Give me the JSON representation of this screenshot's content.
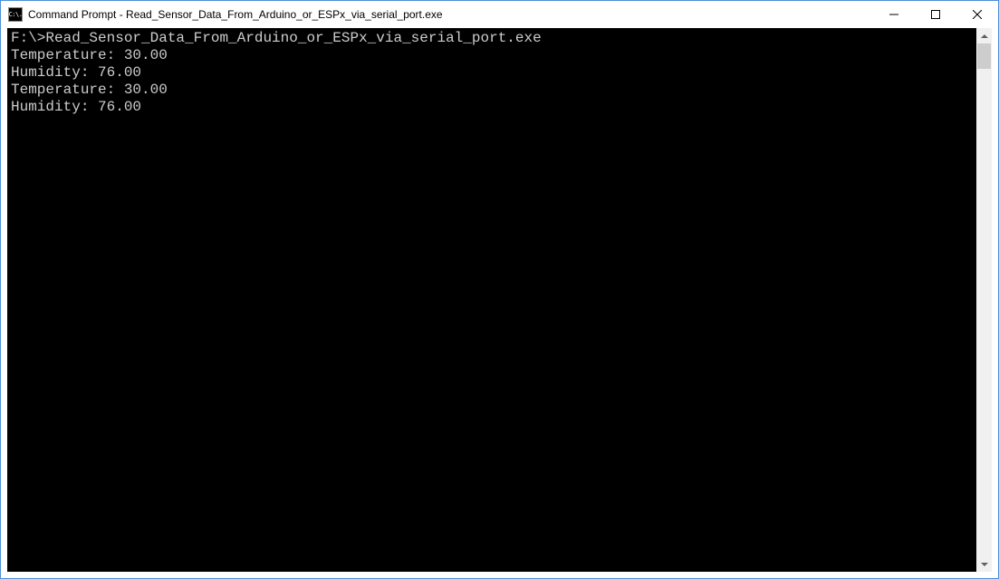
{
  "window": {
    "title": "Command Prompt - Read_Sensor_Data_From_Arduino_or_ESPx_via_serial_port.exe",
    "icon_text": "C:\\."
  },
  "terminal": {
    "lines": [
      "",
      "F:\\>Read_Sensor_Data_From_Arduino_or_ESPx_via_serial_port.exe",
      "Temperature: 30.00",
      "Humidity: 76.00",
      "Temperature: 30.00",
      "Humidity: 76.00"
    ]
  }
}
